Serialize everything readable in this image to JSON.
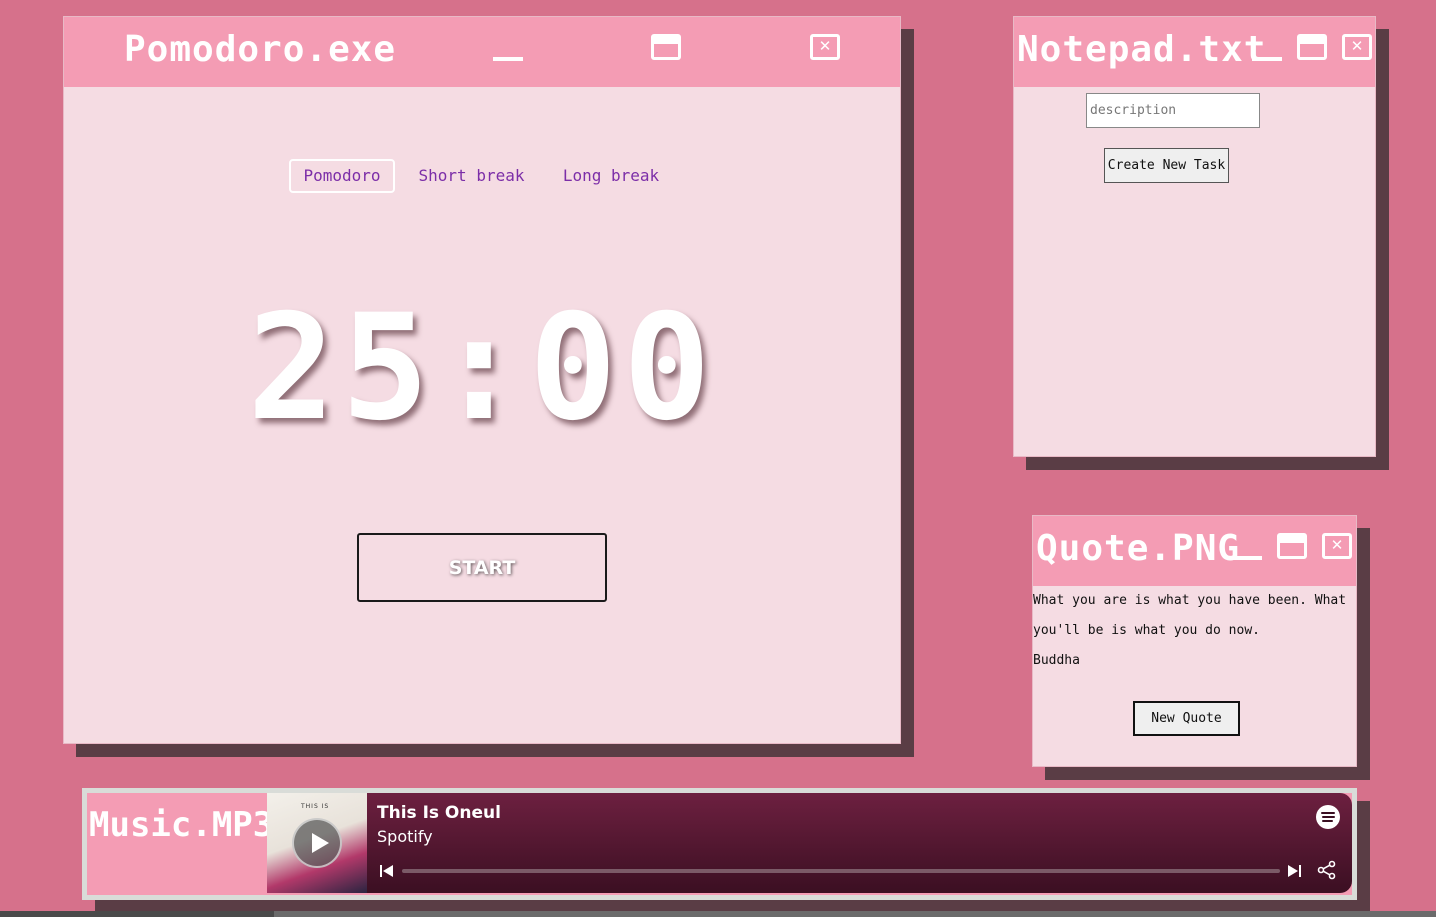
{
  "pomodoro": {
    "title": "Pomodoro.exe",
    "tabs": [
      "Pomodoro",
      "Short break",
      "Long break"
    ],
    "active_tab": "Pomodoro",
    "timer": "25:00",
    "start_label": "START"
  },
  "notepad": {
    "title": "Notepad.txt",
    "description_placeholder": "description",
    "create_label": "Create New Task"
  },
  "quote": {
    "title": "Quote.PNG",
    "text": "What you are is what you have been. What you'll be is what you do now.",
    "author": "Buddha",
    "new_quote_label": "New Quote"
  },
  "music": {
    "title": "Music.MP3",
    "track_title": "This Is Oneul",
    "track_artist": "Spotify",
    "cover_label": "THIS IS",
    "icons": [
      "play-icon",
      "spotify-logo-icon",
      "previous-icon",
      "next-icon",
      "share-icon"
    ]
  },
  "window_controls": {
    "close_glyph": "✕"
  },
  "colors": {
    "desktop": "#d6718b",
    "titlebar": "#f49cb4",
    "window_body": "#f5dce3",
    "shadow": "#5a3d45",
    "tab_text": "#7c2ea8",
    "player_top": "#6d2040",
    "player_bottom": "#3b0f22"
  }
}
